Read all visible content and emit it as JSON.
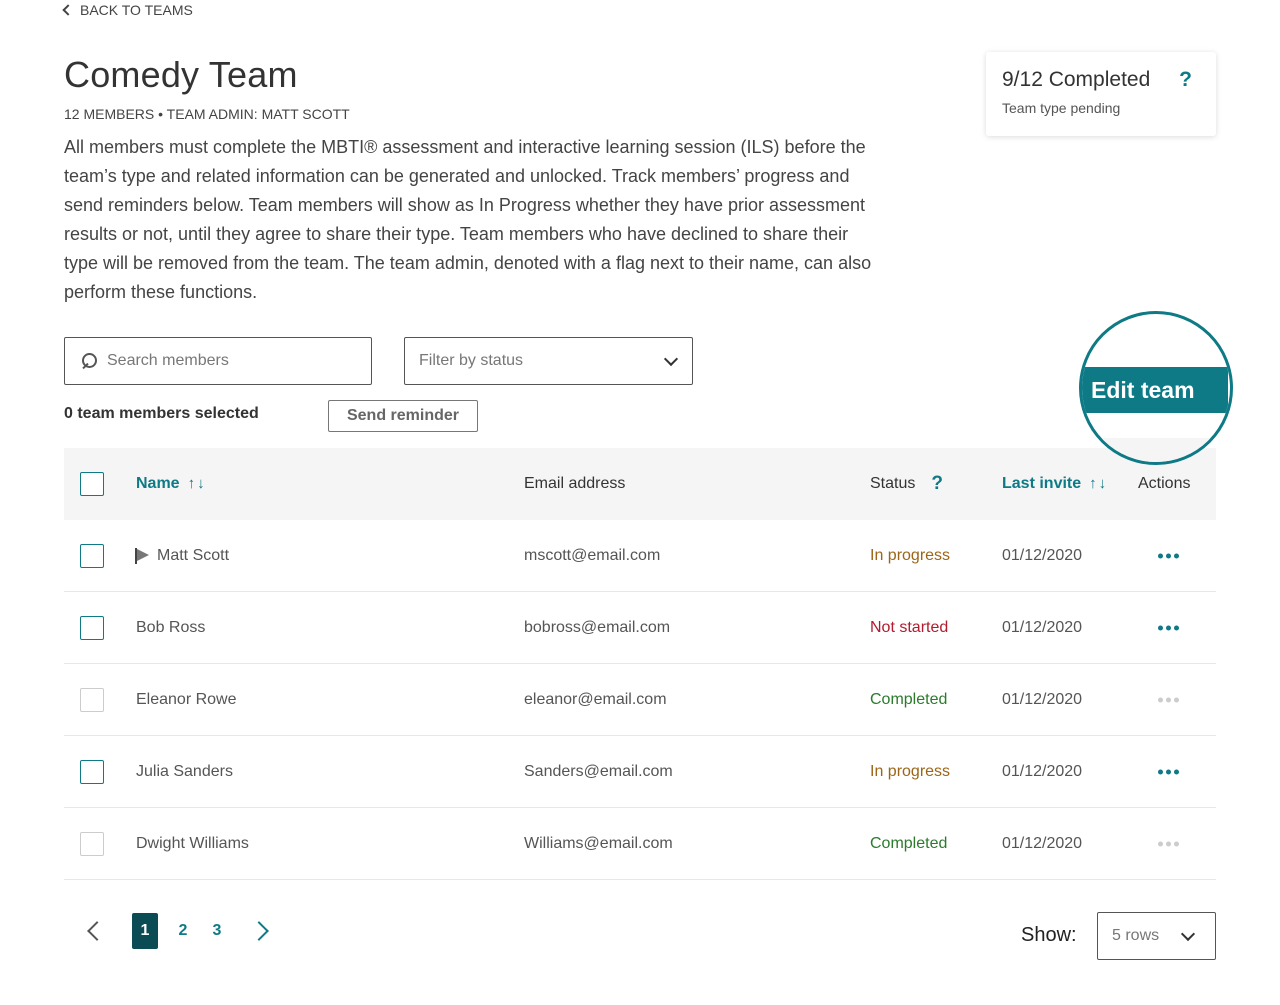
{
  "nav": {
    "back_label": "BACK TO TEAMS"
  },
  "team": {
    "title": "Comedy Team",
    "meta": "12 MEMBERS • TEAM ADMIN: MATT SCOTT",
    "description": "All members must complete the MBTI® assessment and interactive learning session (ILS) before the team’s type and related information can be generated and unlocked. Track members’ progress and send reminders below. Team members will show as In Progress whether they have prior assessment results or not, until they agree to share their type. Team members who have declined to share their type will be removed from the team. The team admin, denoted with a flag next to their name, can also perform these functions."
  },
  "summary": {
    "completed": "9/12 Completed",
    "help": "?",
    "pending": "Team type pending"
  },
  "search": {
    "placeholder": "Search members"
  },
  "filter": {
    "placeholder": "Filter by status"
  },
  "selection": {
    "count_label": "0 team members selected",
    "reminder_label": "Send reminder"
  },
  "edit": {
    "label": "Edit team"
  },
  "table": {
    "headers": {
      "name": "Name",
      "email": "Email address",
      "status": "Status",
      "status_help": "?",
      "last_invite": "Last invite",
      "actions": "Actions"
    },
    "rows": [
      {
        "name": "Matt Scott",
        "admin": true,
        "email": "mscott@email.com",
        "status": "In progress",
        "status_type": "progress",
        "last_invite": "01/12/2020",
        "enabled": true
      },
      {
        "name": "Bob Ross",
        "admin": false,
        "email": "bobross@email.com",
        "status": "Not started",
        "status_type": "notstarted",
        "last_invite": "01/12/2020",
        "enabled": true
      },
      {
        "name": "Eleanor Rowe",
        "admin": false,
        "email": "eleanor@email.com",
        "status": "Completed",
        "status_type": "completed",
        "last_invite": "01/12/2020",
        "enabled": false
      },
      {
        "name": "Julia Sanders",
        "admin": false,
        "email": "Sanders@email.com",
        "status": "In progress",
        "status_type": "progress",
        "last_invite": "01/12/2020",
        "enabled": true
      },
      {
        "name": "Dwight Williams",
        "admin": false,
        "email": "Williams@email.com",
        "status": "Completed",
        "status_type": "completed",
        "last_invite": "01/12/2020",
        "enabled": false
      }
    ]
  },
  "pagination": {
    "pages": [
      "1",
      "2",
      "3"
    ],
    "current": "1"
  },
  "rows_per_page": {
    "label": "Show:",
    "value": "5 rows"
  },
  "colors": {
    "accent": "#0d7a86",
    "active_page": "#0b4b54",
    "in_progress": "#9c6517",
    "not_started": "#b01c2e",
    "completed": "#2c7a2c"
  }
}
